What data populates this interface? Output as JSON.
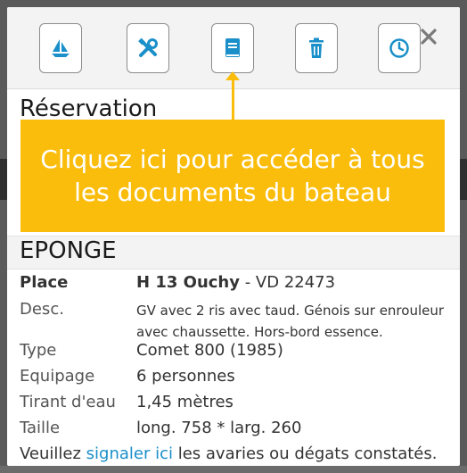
{
  "toolbar": {
    "buttons": [
      {
        "name": "sailboat-icon",
        "label": "Bateau"
      },
      {
        "name": "tools-icon",
        "label": "Outils"
      },
      {
        "name": "book-icon",
        "label": "Documents"
      },
      {
        "name": "trash-icon",
        "label": "Supprimer"
      },
      {
        "name": "clock-icon",
        "label": "Historique"
      }
    ],
    "close_label": "×"
  },
  "reservation": {
    "title": "Réservation"
  },
  "tooltip": {
    "text": "Cliquez ici pour accéder à tous les documents du bateau"
  },
  "boat": {
    "name": "EPONGE",
    "place_label": "Place",
    "place_value": "H 13 Ouchy",
    "place_suffix": " - VD 22473",
    "desc_label": "Desc.",
    "desc_value": "GV avec 2 ris avec taud. Génois sur enrouleur avec chaussette. Hors-bord essence.",
    "type_label": "Type",
    "type_value": "Comet 800 (1985)",
    "crew_label": "Equipage",
    "crew_value": "6 personnes",
    "draft_label": "Tirant d'eau",
    "draft_value": "1,45 mètres",
    "size_label": "Taille",
    "size_value": "long. 758 * larg. 260",
    "report_prefix": "Veuillez ",
    "report_link": "signaler ici",
    "report_suffix": " les avaries ou dégats constatés."
  },
  "colors": {
    "accent": "#1a8fc9",
    "tooltip": "#fbbd0c",
    "toolbar_bg": "#f3f3f3"
  }
}
